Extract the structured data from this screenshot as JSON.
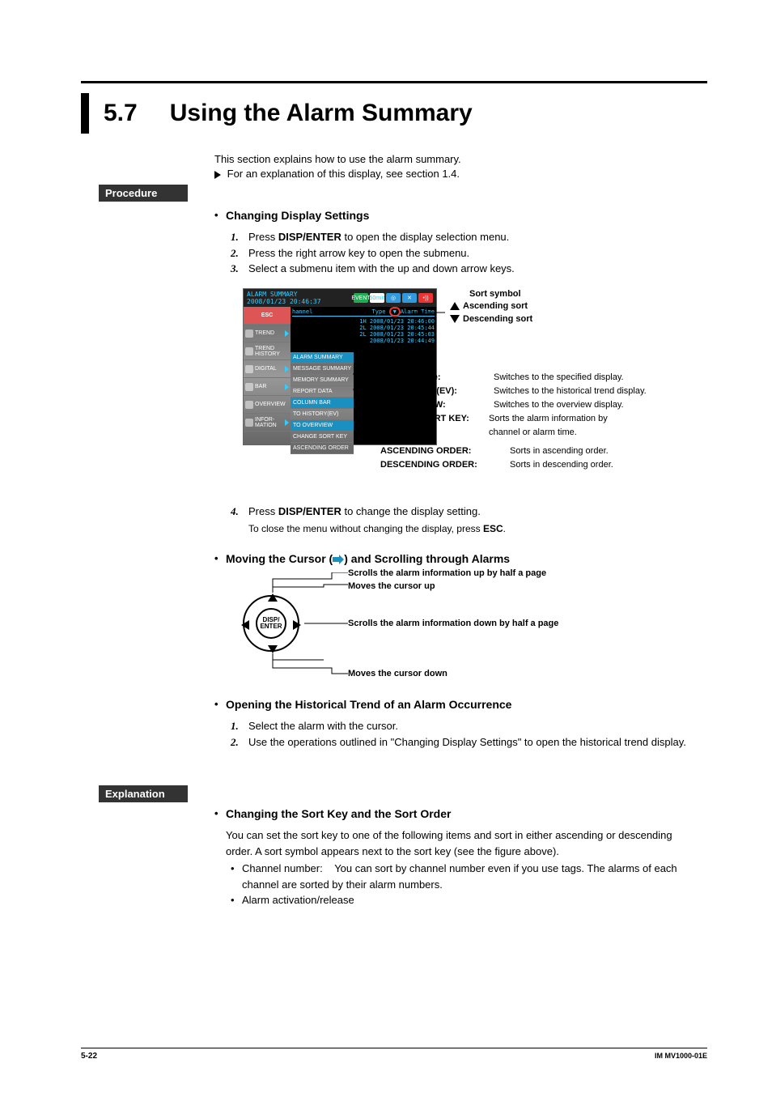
{
  "heading": {
    "num": "5.7",
    "title": "Using the Alarm Summary"
  },
  "intro": {
    "line1": "This section explains how to use the alarm summary.",
    "line2": "For an explanation of this display, see section 1.4."
  },
  "labels": {
    "procedure": "Procedure",
    "explanation": "Explanation"
  },
  "sub1": {
    "title": "Changing Display Settings",
    "steps": [
      {
        "n": "1.",
        "pre": "Press ",
        "bold": "DISP/ENTER",
        "post": " to open the display selection menu."
      },
      {
        "n": "2.",
        "pre": "Press the right arrow key to open the submenu.",
        "bold": "",
        "post": ""
      },
      {
        "n": "3.",
        "pre": "Select a submenu item with the up and down arrow keys.",
        "bold": "",
        "post": ""
      }
    ],
    "step4": {
      "n": "4.",
      "pre": "Press ",
      "bold": "DISP/ENTER",
      "post": " to change the display setting."
    },
    "note": "To close the menu without changing the display, press ",
    "note_bold": "ESC",
    "note_post": "."
  },
  "ui": {
    "title1": "ALARM SUMMARY",
    "title2": "2008/01/23 20:46:37",
    "status": {
      "event": "EVENT",
      "rate": "50min"
    },
    "sidebar": {
      "esc": "ESC",
      "items": [
        "TREND",
        "TREND HISTORY",
        "DIGITAL",
        "BAR",
        "OVERVIEW",
        "INFOR-\nMATION"
      ]
    },
    "submenu": [
      "ALARM SUMMARY",
      "MESSAGE SUMMARY",
      "MEMORY SUMMARY",
      "REPORT DATA",
      "COLUMN BAR",
      "TO HISTORY(EV)",
      "TO OVERVIEW",
      "CHANGE SORT KEY",
      "ASCENDING ORDER"
    ],
    "content": {
      "h_left": "hannel",
      "h_mid": "Type",
      "h_right": "Alarm Time",
      "rows": [
        "1H   2008/01/23 20:46:00",
        "2L   2008/01/23 20:45:44",
        "2L   2008/01/23 20:45:03",
        "     2008/01/23 20:44:49"
      ]
    }
  },
  "anno": {
    "sort_symbol": "Sort symbol",
    "asc_sort": "Ascending sort",
    "desc_sort": "Descending sort",
    "rows": [
      {
        "k": "Display name:",
        "v": "Switches to the specified display."
      },
      {
        "k": "TO HISTORY (EV):",
        "v": "Switches to the historical trend display."
      },
      {
        "k": "TO OVERVIEW:",
        "v": "Switches to the overview display."
      }
    ],
    "csk_k": "CHANGE SORT KEY:",
    "csk_v1": "Sorts the alarm information by",
    "csk_v2": "channel or alarm time.",
    "ao_k": "ASCENDING ORDER:",
    "ao_v": "Sorts in ascending order.",
    "do_k": "DESCENDING ORDER:",
    "do_v": "Sorts in descending order."
  },
  "sub3": {
    "title": "Moving the Cursor (    ) and Scrolling through Alarms",
    "labels": {
      "up_half": "Scrolls the alarm information up by half a page",
      "up": "Moves the cursor up",
      "down_half": "Scrolls the alarm information down by half a page",
      "down": "Moves the cursor down"
    },
    "disp": "DISP/\nENTER"
  },
  "sub4": {
    "title": "Opening the Historical Trend of an Alarm Occurrence",
    "steps": [
      {
        "n": "1.",
        "t": "Select the alarm with the cursor."
      },
      {
        "n": "2.",
        "t": "Use the operations outlined in \"Changing Display Settings\" to open the historical trend display."
      }
    ]
  },
  "sub5": {
    "title": "Changing the Sort Key and the Sort Order",
    "p1": "You can set the sort key to one of the following items and sort in either ascending or descending order. A sort symbol appears next to the sort key (see the figure above).",
    "items": [
      {
        "k": "Channel number:",
        "v": "You can sort by channel number even if you use tags. The alarms of each channel are sorted by their alarm numbers."
      },
      {
        "k": "Alarm activation/release",
        "v": ""
      }
    ]
  },
  "footer": {
    "page": "5-22",
    "doc": "IM MV1000-01E"
  }
}
